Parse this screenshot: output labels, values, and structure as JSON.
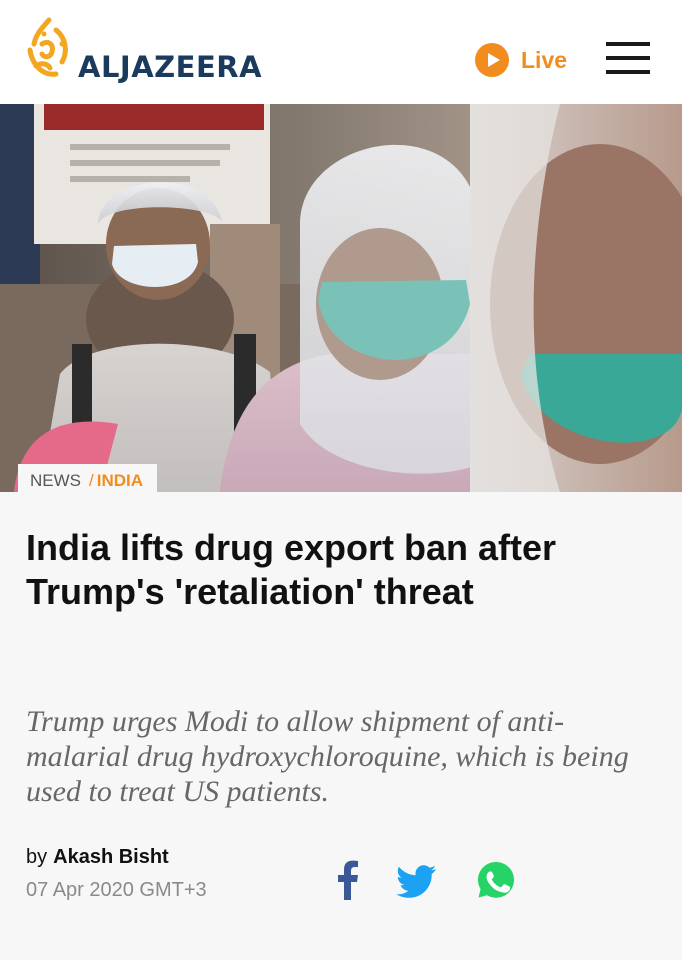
{
  "header": {
    "logo_text": "ALJAZEERA",
    "live_label": "Live"
  },
  "breadcrumb": {
    "section": "NEWS",
    "separator": "/",
    "subsection": "INDIA"
  },
  "article": {
    "headline": "India lifts drug export ban after Trump's 'retaliation' threat",
    "standfirst": "Trump urges Modi to allow shipment of anti-malarial drug hydroxychloroquine, which is being used to treat US patients.",
    "byline_prefix": "by",
    "author": "Akash Bisht",
    "date": "07 Apr 2020 GMT+3"
  },
  "share": {
    "icons": [
      "facebook-icon",
      "twitter-icon",
      "whatsapp-icon"
    ]
  },
  "colors": {
    "brand_orange": "#f28c1e",
    "logo_navy": "#1a3b5d",
    "facebook": "#3b5998",
    "twitter": "#1da1f2",
    "whatsapp": "#25d366"
  }
}
